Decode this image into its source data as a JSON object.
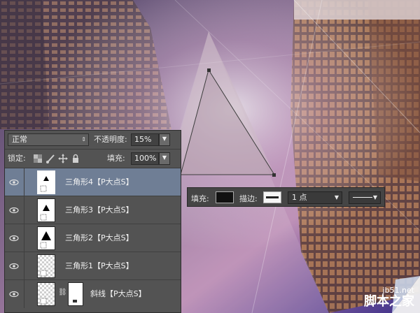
{
  "layers_panel": {
    "blend_mode": "正常",
    "opacity_label": "不透明度:",
    "opacity_value": "15%",
    "lock_label": "锁定:",
    "fill_label": "填充:",
    "fill_value": "100%",
    "layers": [
      {
        "name": "三角形4【P大点S】",
        "selected": true
      },
      {
        "name": "三角形3【P大点S】",
        "selected": false
      },
      {
        "name": "三角形2【P大点S】",
        "selected": false
      },
      {
        "name": "三角形1【P大点S】",
        "selected": false
      },
      {
        "name": "斜线【P大点S】",
        "selected": false
      }
    ]
  },
  "options_bar": {
    "fill_label": "填充:",
    "stroke_label": "描边:",
    "stroke_width": "1 点"
  },
  "watermark": {
    "site": "jb51.net",
    "brand": "脚本之家"
  }
}
